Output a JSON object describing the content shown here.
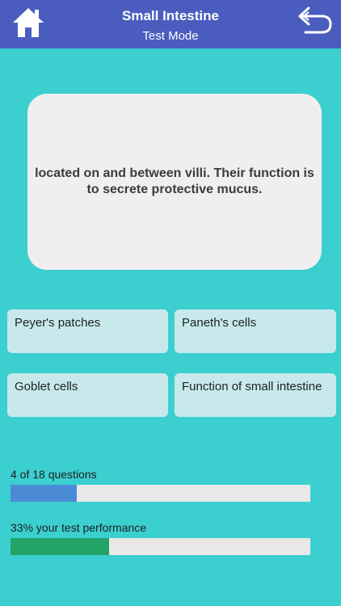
{
  "header": {
    "title": "Small Intestine",
    "subtitle": "Test Mode",
    "home_icon": "home-icon",
    "back_icon": "undo-arrow-icon",
    "background": "#4a5dbf"
  },
  "question": {
    "text": "located on and between villi. Their function is to secrete protective mucus."
  },
  "answers": [
    {
      "label": "Peyer's patches"
    },
    {
      "label": "Paneth's cells"
    },
    {
      "label": "Goblet cells"
    },
    {
      "label": "Function of small intestine"
    }
  ],
  "progress": {
    "label": "4 of 18 questions",
    "current": 4,
    "total": 18,
    "color": "#4b8bd6"
  },
  "performance": {
    "label": "33% your test performance",
    "percent": 33,
    "color": "#22a468"
  },
  "colors": {
    "background": "#3ccfcf",
    "card": "#efefef",
    "answer": "#c7e9eb"
  }
}
